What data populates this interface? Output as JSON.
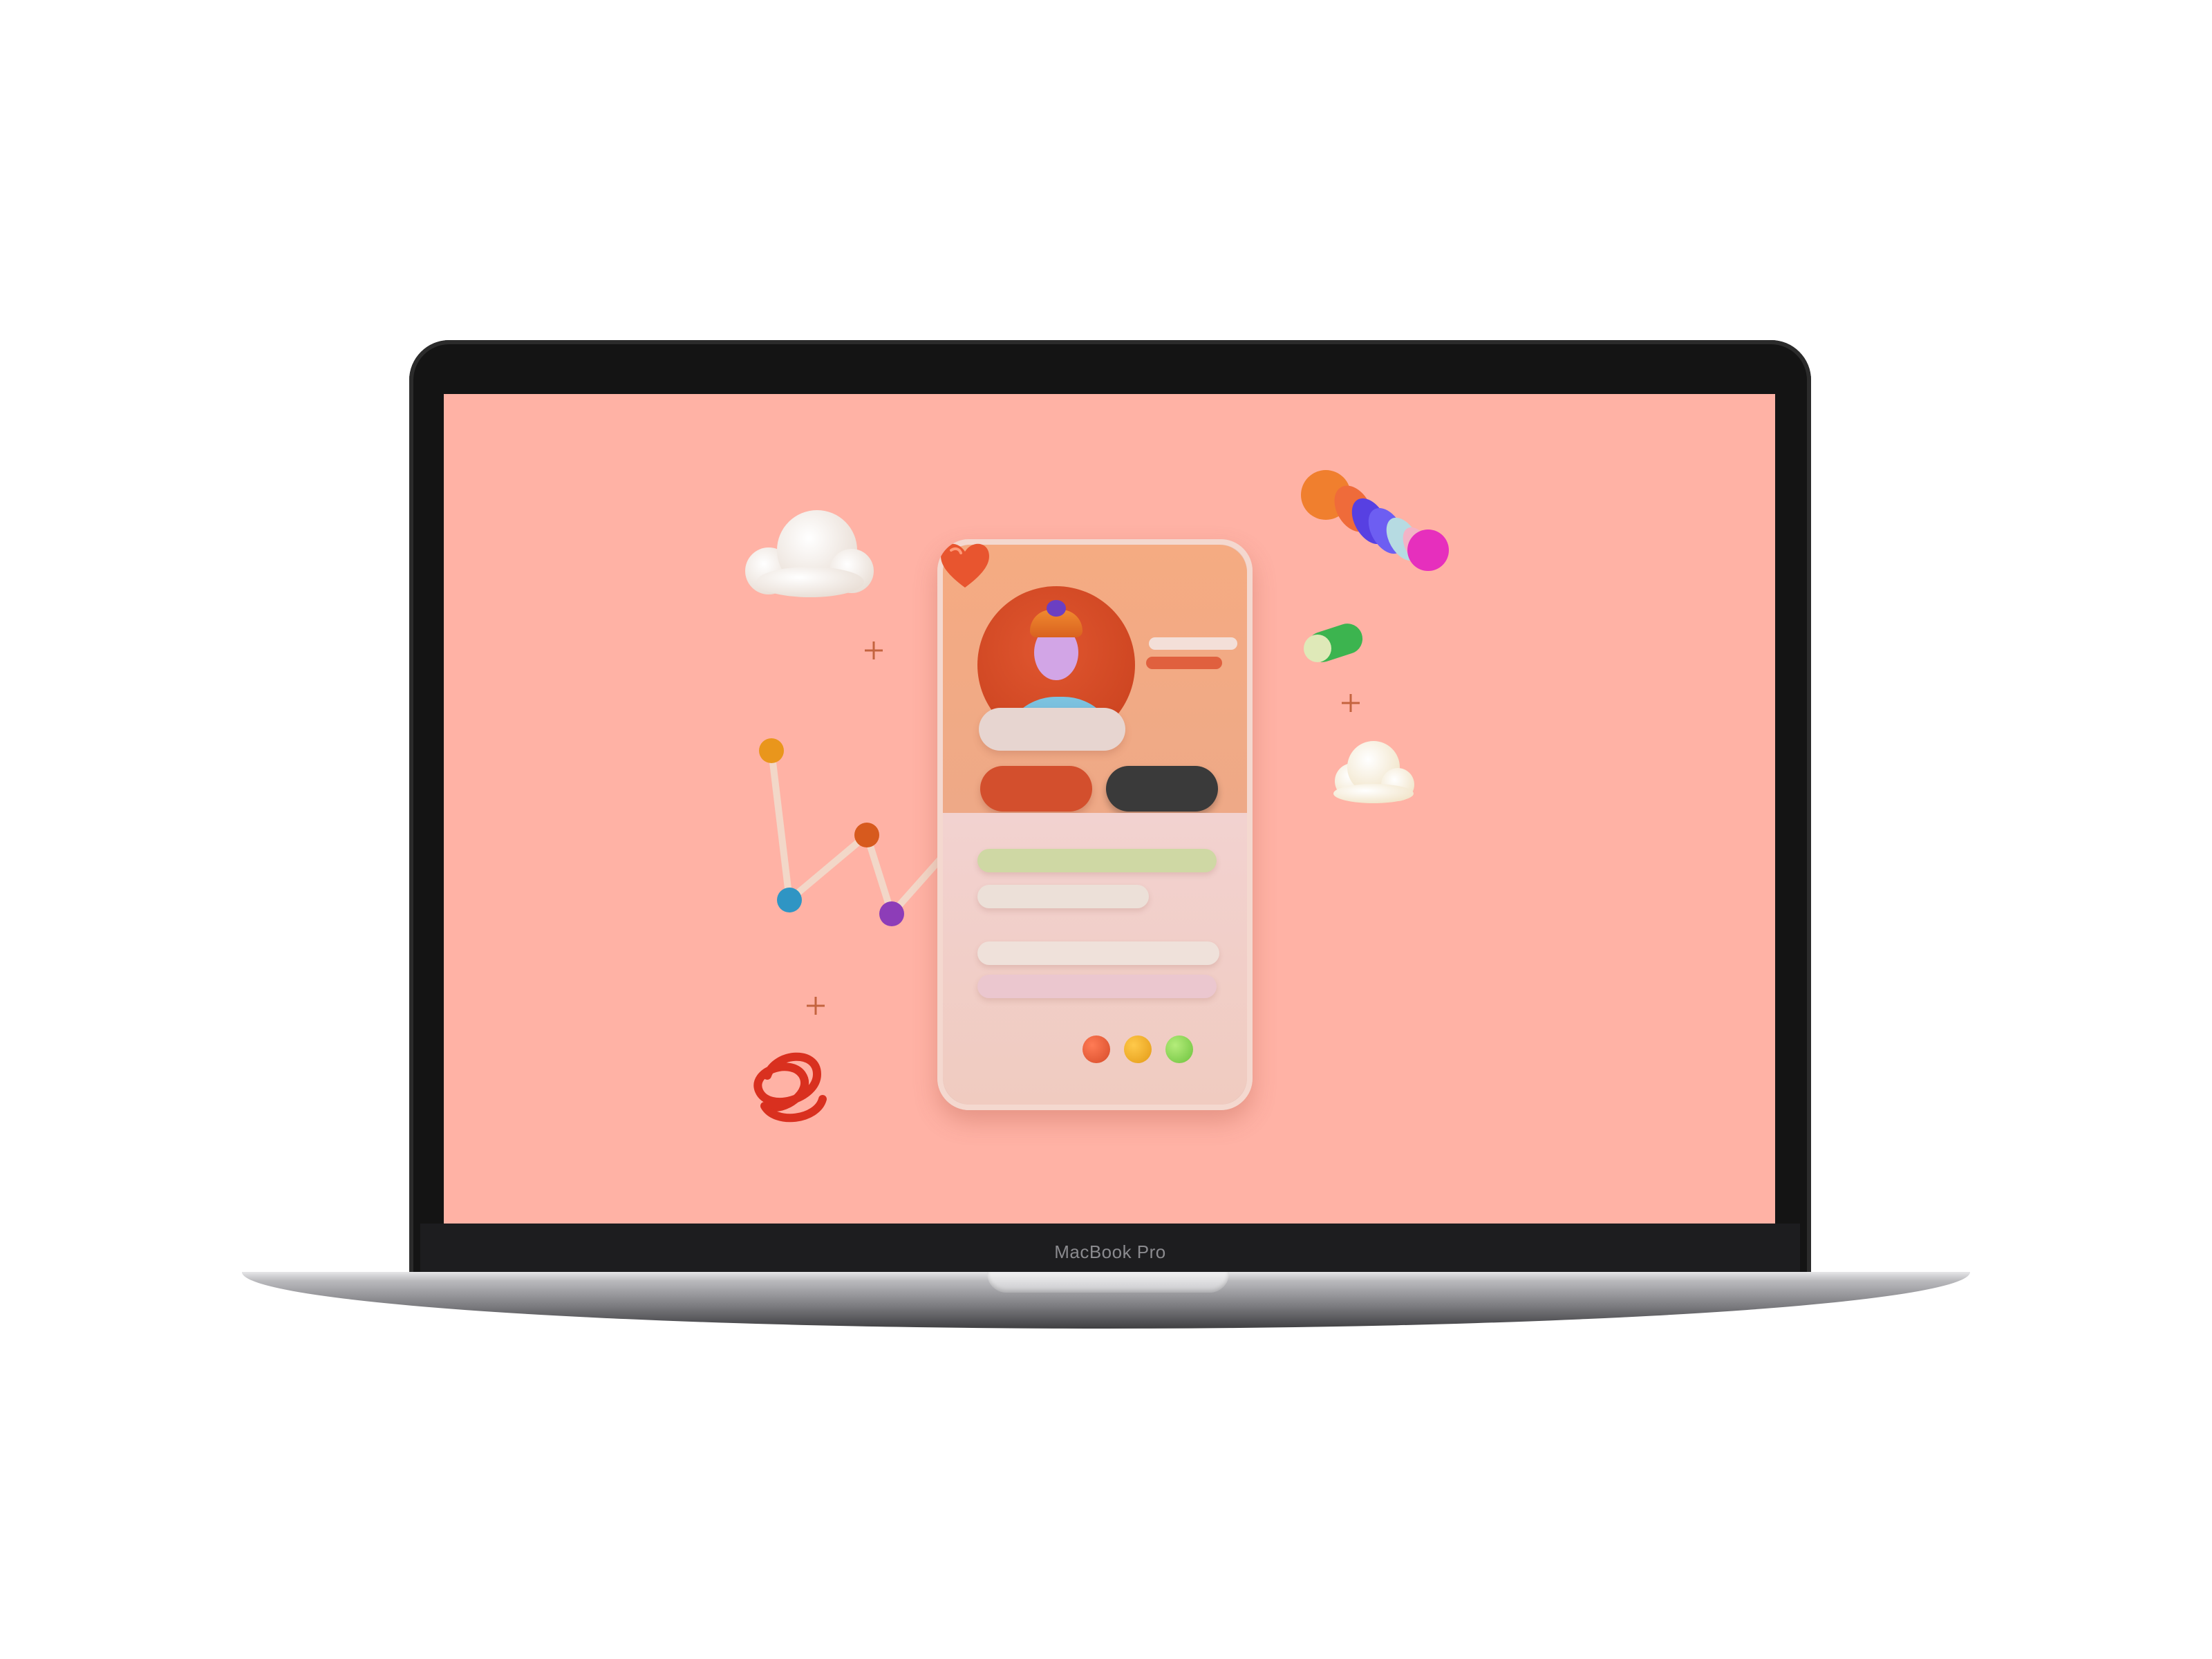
{
  "device": {
    "brand_label": "MacBook Pro"
  },
  "colors": {
    "screen_background": "#ffb2a5",
    "accent_orange": "#d34f2d",
    "dark_button": "#3a3a3a"
  },
  "illustration": {
    "elements": [
      "cloud-icon",
      "line-chart-icon",
      "spiral-icon",
      "sparkle-icon",
      "toggle-icon",
      "color-stack-icon",
      "profile-card",
      "avatar-icon",
      "heart-icon"
    ],
    "color_dots": [
      "#d64b29",
      "#e39a16",
      "#6cc23d"
    ]
  }
}
